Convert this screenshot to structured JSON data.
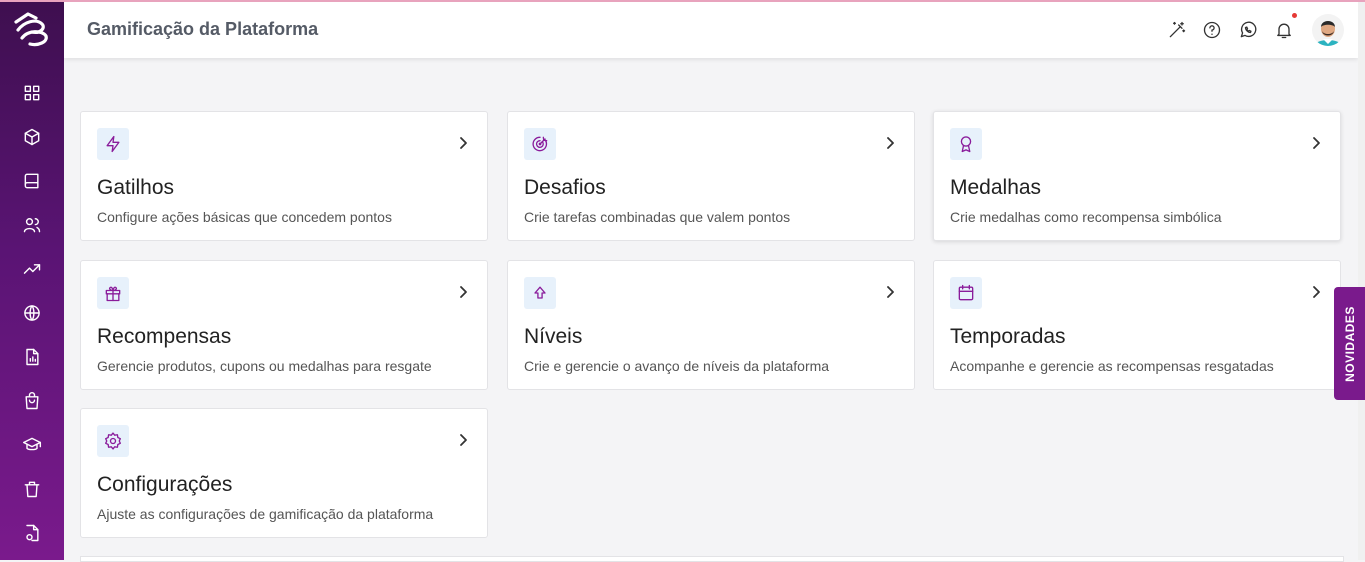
{
  "header": {
    "title": "Gamificação da Plataforma"
  },
  "sidebar": {
    "items": [
      {
        "icon": "grid-icon"
      },
      {
        "icon": "cube-icon"
      },
      {
        "icon": "book-icon"
      },
      {
        "icon": "users-icon"
      },
      {
        "icon": "trending-up-icon"
      },
      {
        "icon": "globe-icon"
      },
      {
        "icon": "report-icon"
      },
      {
        "icon": "shopping-bag-icon"
      },
      {
        "icon": "graduation-cap-icon"
      },
      {
        "icon": "trash-icon"
      },
      {
        "icon": "file-settings-icon"
      }
    ]
  },
  "cards": [
    {
      "title": "Gatilhos",
      "desc": "Configure ações básicas que concedem pontos",
      "icon": "lightning-icon"
    },
    {
      "title": "Desafios",
      "desc": "Crie tarefas combinadas que valem pontos",
      "icon": "target-icon"
    },
    {
      "title": "Medalhas",
      "desc": "Crie medalhas como recompensa simbólica",
      "icon": "award-icon"
    },
    {
      "title": "Recompensas",
      "desc": "Gerencie produtos, cupons ou medalhas para resgate",
      "icon": "gift-icon"
    },
    {
      "title": "Níveis",
      "desc": "Crie e gerencie o avanço de níveis da plataforma",
      "icon": "arrow-up-icon"
    },
    {
      "title": "Temporadas",
      "desc": "Acompanhe e gerencie as recompensas resgatadas",
      "icon": "calendar-icon"
    },
    {
      "title": "Configurações",
      "desc": "Ajuste as configurações de gamificação da plataforma",
      "icon": "gear-icon"
    }
  ],
  "novidades": {
    "label": "NOVIDADES"
  },
  "colors": {
    "accent": "#7a1a8c",
    "sidebar_top": "#3e0f4f",
    "icon_bg": "#e7f1fb"
  }
}
